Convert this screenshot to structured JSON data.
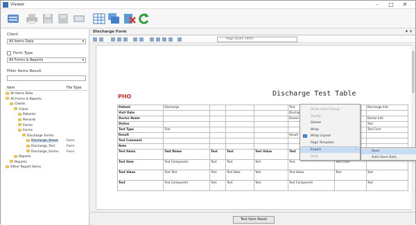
{
  "window": {
    "title": "Viewer",
    "minimize": "–",
    "maximize": "□",
    "close": "✕"
  },
  "toolbar": {
    "icons": [
      "app-icon",
      "print-icon",
      "save-icon",
      "save-as-icon",
      "layout-icon",
      "grid-icon",
      "mdi-icon",
      "excel-close-icon",
      "refresh-icon"
    ]
  },
  "left": {
    "label1": "Client",
    "combo1": "All Items Data",
    "label2": "Form Type",
    "combo2": "All Forms & Reports",
    "label3": "Filter Items Result",
    "tree_headers": [
      "Item",
      "File Type"
    ],
    "tree": [
      {
        "name": "All Items Data",
        "type": "",
        "level": 0
      },
      {
        "name": "All Forms & Reports",
        "type": "",
        "level": 0
      },
      {
        "name": "Clients",
        "type": "",
        "level": 1
      },
      {
        "name": "Client",
        "type": "",
        "level": 2
      },
      {
        "name": "Patients",
        "type": "",
        "level": 3
      },
      {
        "name": "Records",
        "type": "",
        "level": 3
      },
      {
        "name": "Forms",
        "type": "",
        "level": 3
      },
      {
        "name": "Forms",
        "type": "",
        "level": 3
      },
      {
        "name": "Discharge Forms",
        "type": "",
        "level": 4
      },
      {
        "name": "Discharge_Sheet",
        "type": "Form",
        "level": 5,
        "selected": true
      },
      {
        "name": "Discharge_Test",
        "type": "Form",
        "level": 5
      },
      {
        "name": "Discharge_Forms",
        "type": "Form",
        "level": 5
      },
      {
        "name": "Reports",
        "type": "",
        "level": 2
      },
      {
        "name": "Reports",
        "type": "",
        "level": 1
      },
      {
        "name": "Other Report Items",
        "type": "",
        "level": 0
      }
    ]
  },
  "main": {
    "tab": "Discharge Form",
    "zoom": "Page Zoom 100%",
    "logo": "PHO",
    "page_title": "Discharge Test Table",
    "table": [
      [
        "Patient",
        "Discharge",
        "",
        "",
        "",
        "Test",
        "",
        "Discharge Info"
      ],
      [
        "Visit Date",
        "",
        "",
        "",
        "",
        "Discharge Date",
        "",
        ""
      ],
      [
        "Doctor Name",
        "",
        "",
        "",
        "",
        "Doctor",
        "",
        "Doctor Info"
      ],
      [
        "Status",
        "",
        "",
        "",
        "",
        "",
        "",
        "Test"
      ],
      [
        "Test Type",
        "Test",
        "",
        "",
        "",
        "",
        "",
        "Test Form"
      ],
      [
        "Result",
        "",
        "",
        "",
        "",
        "Result",
        "",
        ""
      ],
      [
        "Test Comment",
        "",
        "",
        "",
        "",
        "",
        "",
        ""
      ],
      [
        "Note",
        "",
        "",
        "",
        "",
        "",
        "",
        ""
      ],
      [
        "Test Items",
        "Test Name",
        "Test",
        "Test",
        "Test Value",
        "Test",
        "Test Data",
        "Test"
      ],
      [
        "Test Item",
        "Test Component",
        "Test",
        "Test",
        "Test",
        "Test",
        "Test Code",
        ""
      ],
      [
        "Test Value",
        "Test Test",
        "Test",
        "Test Data",
        "Test",
        "Test Value",
        "Test",
        "Test"
      ],
      [
        "Test",
        "Test Component",
        "Test",
        "Test",
        "Test",
        "Test Component",
        "",
        "Test"
      ]
    ],
    "context_menu": {
      "items": [
        {
          "label": "Show Label Group",
          "disabled": true
        },
        {
          "label": "Tooltip",
          "disabled": true
        },
        {
          "label": "Delete",
          "disabled": false
        },
        {
          "label": "Wrap",
          "disabled": false
        },
        {
          "label": "Wrap Layout",
          "disabled": false,
          "checked": true
        },
        {
          "label": "Page Template",
          "disabled": false
        },
        {
          "label": "Export",
          "disabled": false,
          "has_sub": true,
          "highlighted": true
        },
        {
          "label": "Print",
          "disabled": true
        }
      ],
      "submenu": [
        "Save",
        "Auto Save Data"
      ]
    },
    "footer_button": "Test Item Reset"
  }
}
